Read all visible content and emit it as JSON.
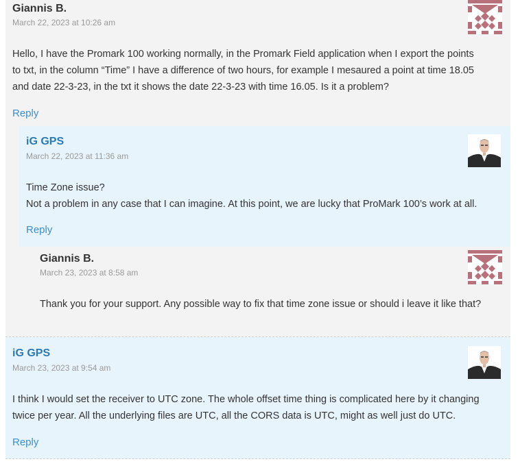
{
  "comments": [
    {
      "author": "Giannis B.",
      "date": "March 22, 2023 at 10:26 am",
      "body": [
        "Hello, I have the Promark 100 working normally, in the Promark Field application when I export the points",
        "to txt, in the column “Time” I have a difference of two hours, for example I mesaured a point at time 18.05",
        "and date 22-3-23, in the txt it shows the date 22-3-23 with time 16.05. Is it a problem?"
      ],
      "reply_label": "Reply",
      "avatar_icon": "identicon-avatar-icon"
    },
    {
      "author": "iG GPS",
      "date": "March 22, 2023 at 11:36 am",
      "body": [
        "Time Zone issue?",
        "Not a problem in any case that I can imagine. At this point, we are lucky that ProMark 100’s work at all."
      ],
      "reply_label": "Reply",
      "avatar_icon": "user-photo-avatar-icon"
    },
    {
      "author": "Giannis B.",
      "date": "March 23, 2023 at 8:58 am",
      "body": [
        "Thank you for your support. Any possible way to fix that time zone issue or should i leave it like that?"
      ],
      "avatar_icon": "identicon-avatar-icon"
    },
    {
      "author": "iG GPS",
      "date": "March 23, 2023 at 9:54 am",
      "body": [
        "I think I would set the receiver to UTC zone. The whole offset time thing is complicated here by it changing",
        "twice per year. All the underlying files are UTC, all the CORS data is UTC, might as well just do UTC."
      ],
      "reply_label": "Reply",
      "avatar_icon": "user-photo-avatar-icon"
    }
  ],
  "colors": {
    "link": "#3a8fd0",
    "admin_author": "#2a7ab8",
    "identicon": "#b8707a",
    "parent_bg": "#f3f3f3",
    "admin_bg": "#e8f4fc"
  }
}
